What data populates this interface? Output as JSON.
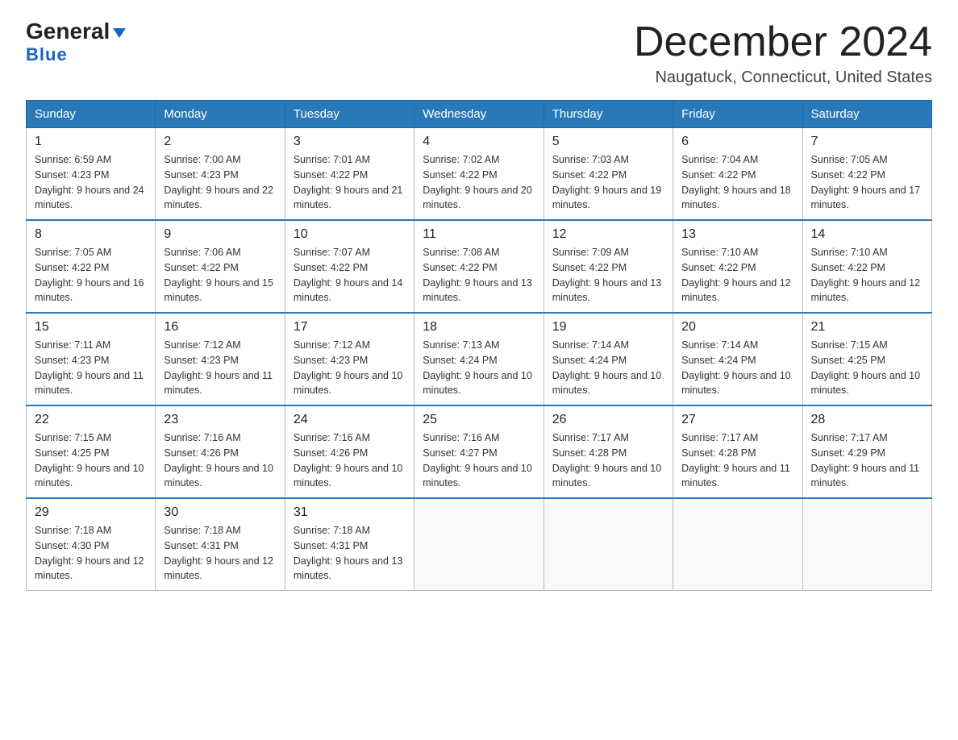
{
  "logo": {
    "line1": "General",
    "line2": "Blue"
  },
  "header": {
    "month": "December 2024",
    "location": "Naugatuck, Connecticut, United States"
  },
  "weekdays": [
    "Sunday",
    "Monday",
    "Tuesday",
    "Wednesday",
    "Thursday",
    "Friday",
    "Saturday"
  ],
  "weeks": [
    [
      {
        "day": "1",
        "sunrise": "6:59 AM",
        "sunset": "4:23 PM",
        "daylight": "9 hours and 24 minutes."
      },
      {
        "day": "2",
        "sunrise": "7:00 AM",
        "sunset": "4:23 PM",
        "daylight": "9 hours and 22 minutes."
      },
      {
        "day": "3",
        "sunrise": "7:01 AM",
        "sunset": "4:22 PM",
        "daylight": "9 hours and 21 minutes."
      },
      {
        "day": "4",
        "sunrise": "7:02 AM",
        "sunset": "4:22 PM",
        "daylight": "9 hours and 20 minutes."
      },
      {
        "day": "5",
        "sunrise": "7:03 AM",
        "sunset": "4:22 PM",
        "daylight": "9 hours and 19 minutes."
      },
      {
        "day": "6",
        "sunrise": "7:04 AM",
        "sunset": "4:22 PM",
        "daylight": "9 hours and 18 minutes."
      },
      {
        "day": "7",
        "sunrise": "7:05 AM",
        "sunset": "4:22 PM",
        "daylight": "9 hours and 17 minutes."
      }
    ],
    [
      {
        "day": "8",
        "sunrise": "7:05 AM",
        "sunset": "4:22 PM",
        "daylight": "9 hours and 16 minutes."
      },
      {
        "day": "9",
        "sunrise": "7:06 AM",
        "sunset": "4:22 PM",
        "daylight": "9 hours and 15 minutes."
      },
      {
        "day": "10",
        "sunrise": "7:07 AM",
        "sunset": "4:22 PM",
        "daylight": "9 hours and 14 minutes."
      },
      {
        "day": "11",
        "sunrise": "7:08 AM",
        "sunset": "4:22 PM",
        "daylight": "9 hours and 13 minutes."
      },
      {
        "day": "12",
        "sunrise": "7:09 AM",
        "sunset": "4:22 PM",
        "daylight": "9 hours and 13 minutes."
      },
      {
        "day": "13",
        "sunrise": "7:10 AM",
        "sunset": "4:22 PM",
        "daylight": "9 hours and 12 minutes."
      },
      {
        "day": "14",
        "sunrise": "7:10 AM",
        "sunset": "4:22 PM",
        "daylight": "9 hours and 12 minutes."
      }
    ],
    [
      {
        "day": "15",
        "sunrise": "7:11 AM",
        "sunset": "4:23 PM",
        "daylight": "9 hours and 11 minutes."
      },
      {
        "day": "16",
        "sunrise": "7:12 AM",
        "sunset": "4:23 PM",
        "daylight": "9 hours and 11 minutes."
      },
      {
        "day": "17",
        "sunrise": "7:12 AM",
        "sunset": "4:23 PM",
        "daylight": "9 hours and 10 minutes."
      },
      {
        "day": "18",
        "sunrise": "7:13 AM",
        "sunset": "4:24 PM",
        "daylight": "9 hours and 10 minutes."
      },
      {
        "day": "19",
        "sunrise": "7:14 AM",
        "sunset": "4:24 PM",
        "daylight": "9 hours and 10 minutes."
      },
      {
        "day": "20",
        "sunrise": "7:14 AM",
        "sunset": "4:24 PM",
        "daylight": "9 hours and 10 minutes."
      },
      {
        "day": "21",
        "sunrise": "7:15 AM",
        "sunset": "4:25 PM",
        "daylight": "9 hours and 10 minutes."
      }
    ],
    [
      {
        "day": "22",
        "sunrise": "7:15 AM",
        "sunset": "4:25 PM",
        "daylight": "9 hours and 10 minutes."
      },
      {
        "day": "23",
        "sunrise": "7:16 AM",
        "sunset": "4:26 PM",
        "daylight": "9 hours and 10 minutes."
      },
      {
        "day": "24",
        "sunrise": "7:16 AM",
        "sunset": "4:26 PM",
        "daylight": "9 hours and 10 minutes."
      },
      {
        "day": "25",
        "sunrise": "7:16 AM",
        "sunset": "4:27 PM",
        "daylight": "9 hours and 10 minutes."
      },
      {
        "day": "26",
        "sunrise": "7:17 AM",
        "sunset": "4:28 PM",
        "daylight": "9 hours and 10 minutes."
      },
      {
        "day": "27",
        "sunrise": "7:17 AM",
        "sunset": "4:28 PM",
        "daylight": "9 hours and 11 minutes."
      },
      {
        "day": "28",
        "sunrise": "7:17 AM",
        "sunset": "4:29 PM",
        "daylight": "9 hours and 11 minutes."
      }
    ],
    [
      {
        "day": "29",
        "sunrise": "7:18 AM",
        "sunset": "4:30 PM",
        "daylight": "9 hours and 12 minutes."
      },
      {
        "day": "30",
        "sunrise": "7:18 AM",
        "sunset": "4:31 PM",
        "daylight": "9 hours and 12 minutes."
      },
      {
        "day": "31",
        "sunrise": "7:18 AM",
        "sunset": "4:31 PM",
        "daylight": "9 hours and 13 minutes."
      },
      null,
      null,
      null,
      null
    ]
  ]
}
